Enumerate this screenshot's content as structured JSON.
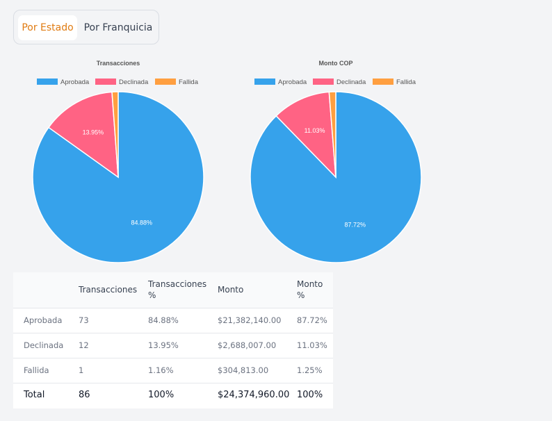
{
  "tabs": [
    {
      "label": "Por Estado",
      "active": true
    },
    {
      "label": "Por Franquicia",
      "active": false
    }
  ],
  "colors": {
    "aprobada": "#36a2eb",
    "declinada": "#ff6384",
    "fallida": "#ff9f40",
    "active_tab_text": "#e07b12"
  },
  "chart_data": [
    {
      "type": "pie",
      "title": "Transacciones",
      "legend_position": "top",
      "categories": [
        "Aprobada",
        "Declinada",
        "Fallida"
      ],
      "values": [
        73,
        12,
        1
      ],
      "percent_labels": [
        "84.88%",
        "13.95%",
        ""
      ]
    },
    {
      "type": "pie",
      "title": "Monto COP",
      "legend_position": "top",
      "categories": [
        "Aprobada",
        "Declinada",
        "Fallida"
      ],
      "values": [
        21382140.0,
        2688007.0,
        304813.0
      ],
      "percent_labels": [
        "87.72%",
        "11.03%",
        ""
      ]
    }
  ],
  "table": {
    "headers": [
      "",
      "Transacciones",
      "Transacciones %",
      "Monto",
      "Monto %"
    ],
    "header_lines": [
      [
        ""
      ],
      [
        "Transacciones"
      ],
      [
        "Transacciones",
        "%"
      ],
      [
        "Monto"
      ],
      [
        "Monto",
        "%"
      ]
    ],
    "rows": [
      [
        "Aprobada",
        "73",
        "84.88%",
        "$21,382,140.00",
        "87.72%"
      ],
      [
        "Declinada",
        "12",
        "13.95%",
        "$2,688,007.00",
        "11.03%"
      ],
      [
        "Fallida",
        "1",
        "1.16%",
        "$304,813.00",
        "1.25%"
      ]
    ],
    "total": [
      "Total",
      "86",
      "100%",
      "$24,374,960.00",
      "100%"
    ]
  }
}
